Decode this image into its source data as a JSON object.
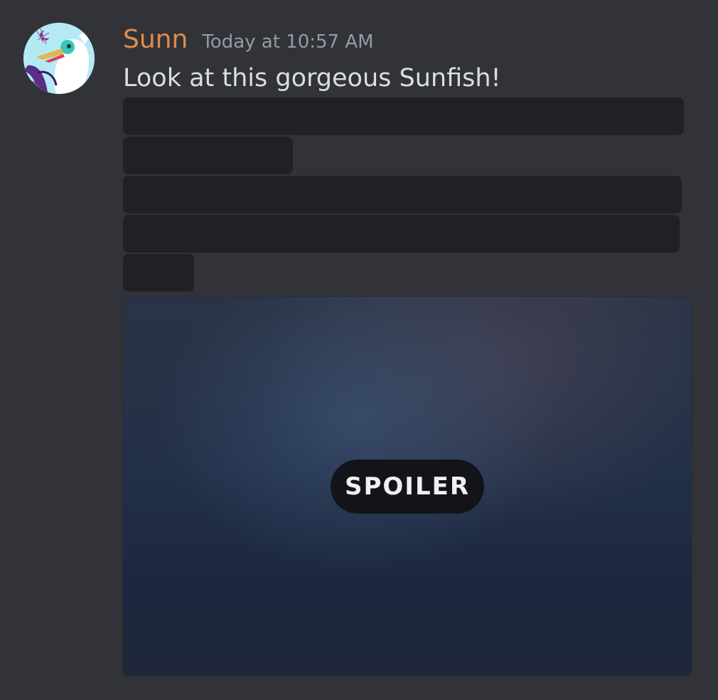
{
  "message": {
    "author": {
      "name": "Sunn",
      "name_color": "#e38b49",
      "avatar_icon": "white-bird-avatar-icon"
    },
    "timestamp": "Today at 10:57 AM",
    "content": "Look at this gorgeous Sunfish!",
    "hidden_spoiler_text_lines": 5,
    "attachment": {
      "spoiler_label": "SPOILER"
    }
  },
  "colors": {
    "background": "#313338",
    "text": "#dbdee1",
    "muted": "#949ba4",
    "spoiler_block": "#202124"
  }
}
